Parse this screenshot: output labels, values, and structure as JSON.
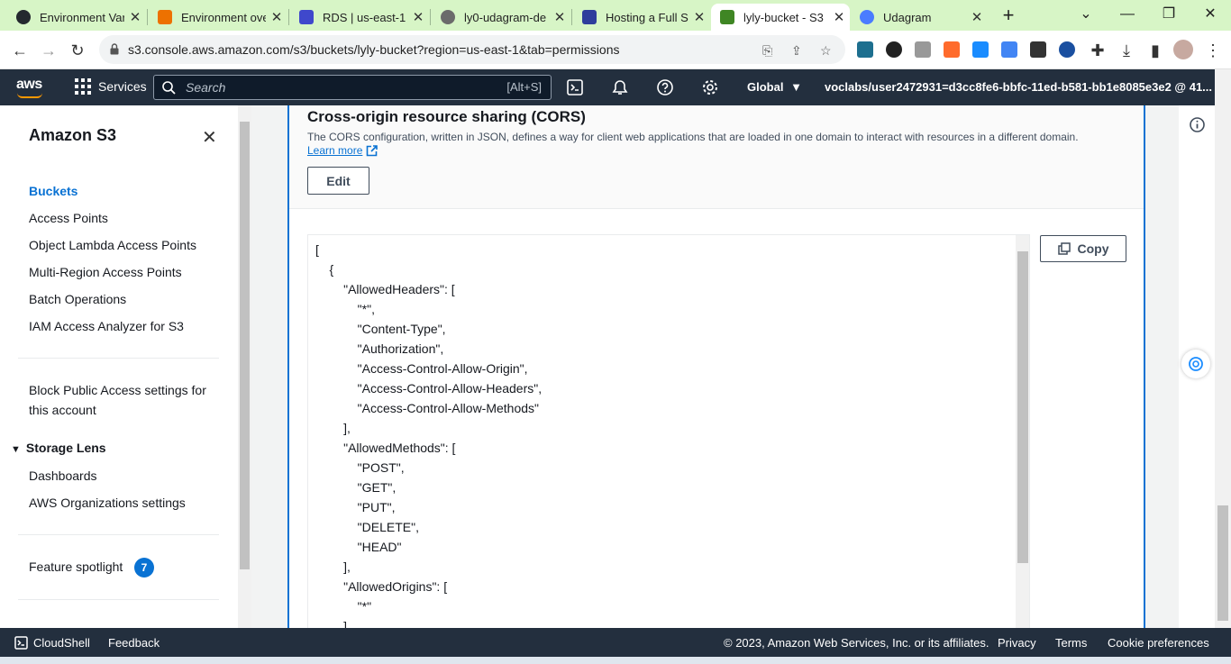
{
  "browser": {
    "tabs": [
      {
        "title": "Environment Var",
        "icon": "github-icon",
        "color": "#24292f"
      },
      {
        "title": "Environment ove",
        "icon": "aws-orange-icon",
        "color": "#ed7100"
      },
      {
        "title": "RDS | us-east-1",
        "icon": "rds-icon",
        "color": "#3f48cc"
      },
      {
        "title": "ly0-udagram-de",
        "icon": "globe-icon",
        "color": "#6b6b6b"
      },
      {
        "title": "Hosting a Full St",
        "icon": "udacity-icon",
        "color": "#2e3d9c"
      },
      {
        "title": "lyly-bucket - S3",
        "icon": "s3-icon",
        "color": "#3f8624",
        "active": true
      },
      {
        "title": "Udagram",
        "icon": "globe-icon",
        "color": "#4a7cff"
      }
    ],
    "url": "s3.console.aws.amazon.com/s3/buckets/lyly-bucket?region=us-east-1&tab=permissions"
  },
  "aws_nav": {
    "logo": "aws",
    "services_label": "Services",
    "search_placeholder": "Search",
    "search_shortcut": "[Alt+S]",
    "region": "Global",
    "account": "voclabs/user2472931=d3cc8fe6-bbfc-11ed-b581-bb1e8085e3e2 @ 41..."
  },
  "sidebar": {
    "title": "Amazon S3",
    "items": [
      {
        "label": "Buckets",
        "active": true
      },
      {
        "label": "Access Points"
      },
      {
        "label": "Object Lambda Access Points"
      },
      {
        "label": "Multi-Region Access Points"
      },
      {
        "label": "Batch Operations"
      },
      {
        "label": "IAM Access Analyzer for S3"
      }
    ],
    "block_public_line1": "Block Public Access settings for",
    "block_public_line2": "this account",
    "storage_lens": "Storage Lens",
    "storage_lens_items": [
      "Dashboards",
      "AWS Organizations settings"
    ],
    "feature_spotlight": "Feature spotlight",
    "feature_spotlight_count": "7"
  },
  "cors": {
    "title": "Cross-origin resource sharing (CORS)",
    "description": "The CORS configuration, written in JSON, defines a way for client web applications that are loaded in one domain to interact with resources in a different domain.",
    "learn_more": "Learn more",
    "edit_label": "Edit",
    "copy_label": "Copy",
    "code_lines": [
      "[",
      "    {",
      "        \"AllowedHeaders\": [",
      "            \"*\",",
      "            \"Content-Type\",",
      "            \"Authorization\",",
      "            \"Access-Control-Allow-Origin\",",
      "            \"Access-Control-Allow-Headers\",",
      "            \"Access-Control-Allow-Methods\"",
      "        ],",
      "        \"AllowedMethods\": [",
      "            \"POST\",",
      "            \"GET\",",
      "            \"PUT\",",
      "            \"DELETE\",",
      "            \"HEAD\"",
      "        ],",
      "        \"AllowedOrigins\": [",
      "            \"*\"",
      "        ]"
    ]
  },
  "footer": {
    "cloudshell": "CloudShell",
    "feedback": "Feedback",
    "copyright": "© 2023, Amazon Web Services, Inc. or its affiliates.",
    "privacy": "Privacy",
    "terms": "Terms",
    "cookie": "Cookie preferences"
  },
  "colors": {
    "aws_nav_bg": "#232f3e",
    "aws_orange": "#ff9900",
    "link_blue": "#0972d3",
    "tabstrip_green": "#d7f5c6"
  }
}
